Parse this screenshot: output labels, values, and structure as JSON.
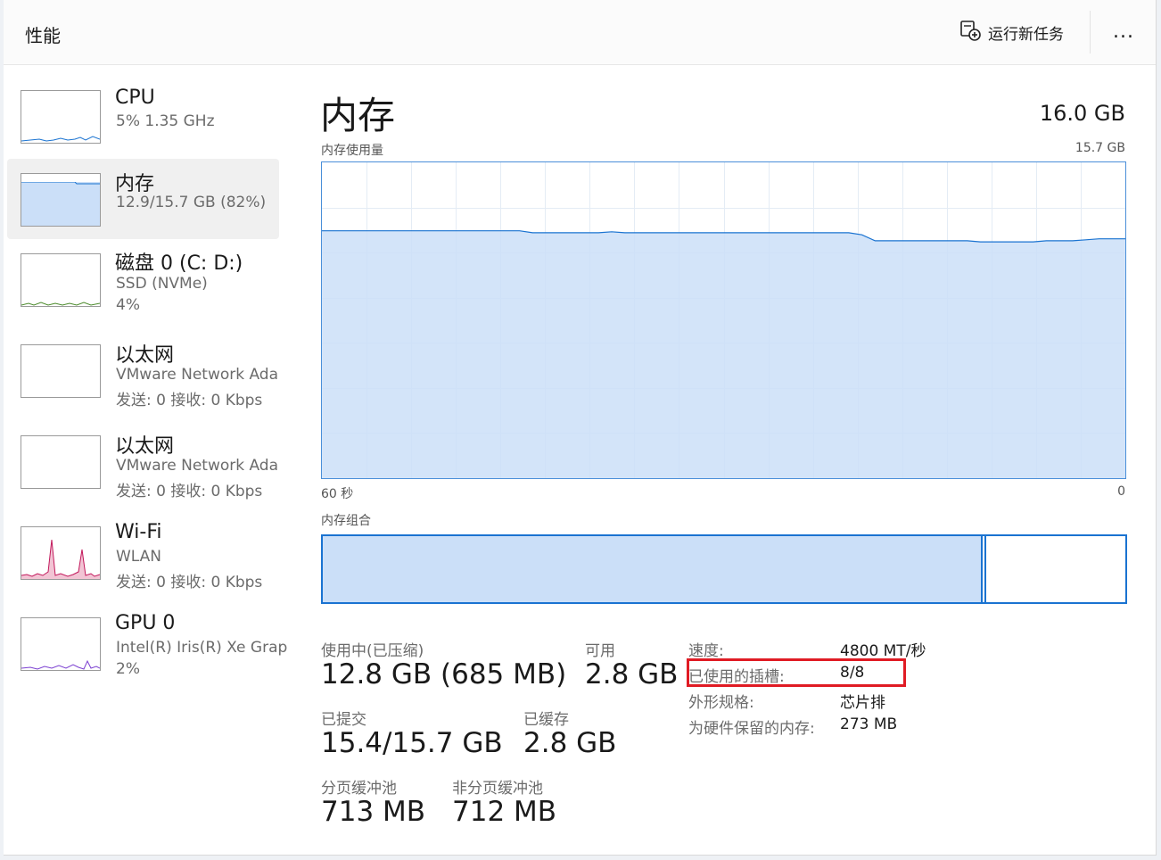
{
  "header": {
    "title": "性能",
    "run_task_label": "运行新任务",
    "more_label": "..."
  },
  "sidebar": {
    "items": [
      {
        "name": "CPU",
        "sub1": "5%  1.35 GHz",
        "sub2": "",
        "color": "#1a73d1"
      },
      {
        "name": "内存",
        "sub1": "12.9/15.7 GB (82%)",
        "sub2": "",
        "color": "#1a73d1"
      },
      {
        "name": "磁盘 0 (C: D:)",
        "sub1": "SSD (NVMe)",
        "sub2": "4%",
        "color": "#4a8a2a"
      },
      {
        "name": "以太网",
        "sub1": "VMware Network Ada",
        "sub2": "发送: 0 接收: 0 Kbps",
        "color": "#a0522d"
      },
      {
        "name": "以太网",
        "sub1": "VMware Network Ada",
        "sub2": "发送: 0 接收: 0 Kbps",
        "color": "#a0522d"
      },
      {
        "name": "Wi-Fi",
        "sub1": "WLAN",
        "sub2": "发送: 0 接收: 0 Kbps",
        "color": "#c2185b"
      },
      {
        "name": "GPU 0",
        "sub1": "Intel(R) Iris(R) Xe Grap",
        "sub2": "2%",
        "color": "#7b3fd1"
      }
    ]
  },
  "main": {
    "title": "内存",
    "total": "16.0 GB",
    "usage_label": "内存使用量",
    "usage_max": "15.7 GB",
    "axis_left": "60 秒",
    "axis_right": "0",
    "composition_label": "内存组合"
  },
  "stats": {
    "in_use_label": "使用中(已压缩)",
    "in_use_value": "12.8 GB (685 MB)",
    "available_label": "可用",
    "available_value": "2.8 GB",
    "committed_label": "已提交",
    "committed_value": "15.4/15.7 GB",
    "cached_label": "已缓存",
    "cached_value": "2.8 GB",
    "paged_label": "分页缓冲池",
    "paged_value": "713 MB",
    "nonpaged_label": "非分页缓冲池",
    "nonpaged_value": "712 MB"
  },
  "details": {
    "speed_label": "速度:",
    "speed_value": "4800 MT/秒",
    "slots_label": "已使用的插槽:",
    "slots_value": "8/8",
    "form_label": "外形规格:",
    "form_value": "芯片排",
    "reserved_label": "为硬件保留的内存:",
    "reserved_value": "273 MB"
  },
  "chart_data": {
    "type": "area",
    "x_range": [
      60,
      0
    ],
    "ylim": [
      0,
      15.7
    ],
    "values": [
      12.3,
      12.3,
      12.3,
      12.3,
      12.3,
      12.3,
      12.3,
      12.3,
      12.3,
      12.3,
      12.3,
      12.3,
      12.3,
      12.3,
      12.3,
      12.3,
      12.2,
      12.2,
      12.2,
      12.2,
      12.2,
      12.2,
      12.25,
      12.2,
      12.2,
      12.2,
      12.2,
      12.2,
      12.2,
      12.2,
      12.2,
      12.2,
      12.2,
      12.2,
      12.2,
      12.2,
      12.2,
      12.2,
      12.2,
      12.2,
      12.2,
      12.1,
      11.8,
      11.8,
      11.8,
      11.8,
      11.8,
      11.8,
      11.8,
      11.8,
      11.75,
      11.75,
      11.75,
      11.75,
      11.75,
      11.8,
      11.8,
      11.8,
      11.85,
      11.9,
      11.9,
      11.9
    ]
  }
}
